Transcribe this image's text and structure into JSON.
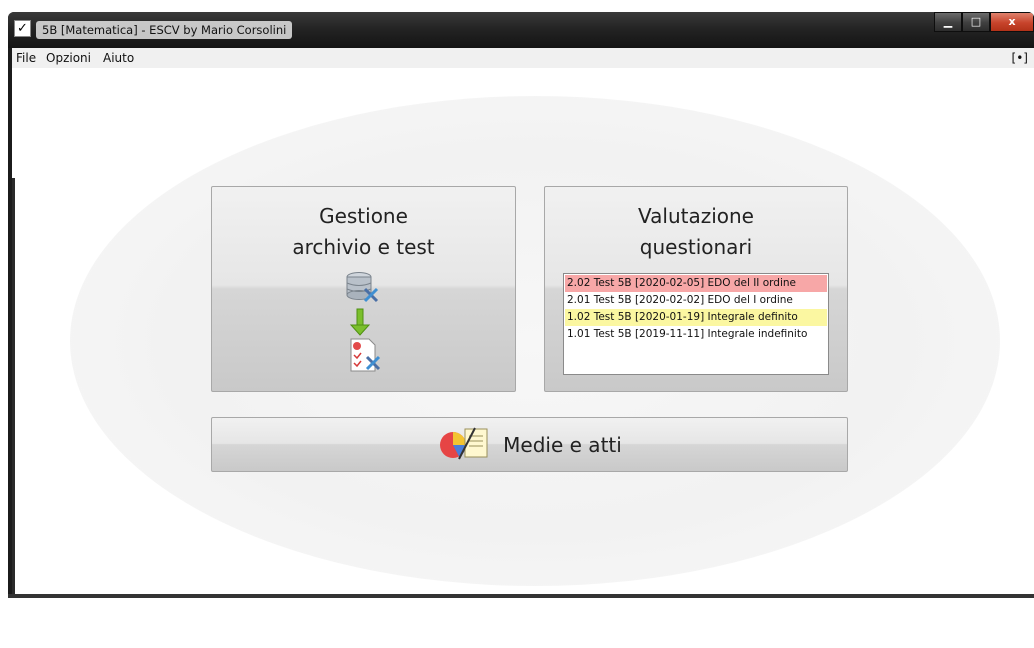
{
  "window": {
    "title": "5B [Matematica] - ESCV by Mario Corsolini",
    "app_icon_glyph": "✓",
    "minimize_glyph": "▁",
    "maximize_glyph": "□",
    "close_glyph": "x"
  },
  "menu": {
    "file": "File",
    "opzioni": "Opzioni",
    "aiuto": "Aiuto",
    "fullscreen_toggle": "[•]"
  },
  "main": {
    "gestione_title": "Gestione\narchivio e test",
    "valutazione_title": "Valutazione\nquestionari",
    "medie_label": "Medie e atti",
    "questionari": [
      {
        "label": "2.02 Test 5B [2020-02-05] EDO del II ordine",
        "highlight": "#f7a7a7"
      },
      {
        "label": "2.01 Test 5B [2020-02-02] EDO del I ordine",
        "highlight": "#ffffff"
      },
      {
        "label": "1.02 Test 5B [2020-01-19] Integrale definito",
        "highlight": "#fbf7a1"
      },
      {
        "label": "1.01 Test 5B [2019-11-11] Integrale indefinito",
        "highlight": "#ffffff"
      }
    ]
  },
  "icons": {
    "gestione": "database-to-test-icon",
    "medie": "pie-chart-document-icon"
  }
}
